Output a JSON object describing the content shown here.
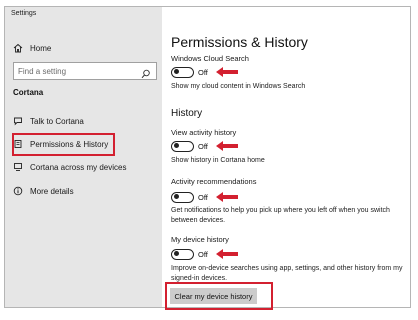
{
  "window": {
    "title": "Settings"
  },
  "sidebar": {
    "home_label": "Home",
    "search_placeholder": "Find a setting",
    "section_title": "Cortana",
    "items": [
      {
        "label": "Talk to Cortana",
        "icon": "cortana-chat-icon"
      },
      {
        "label": "Permissions & History",
        "icon": "permissions-icon",
        "highlighted": true
      },
      {
        "label": "Cortana across my devices",
        "icon": "devices-icon"
      },
      {
        "label": "More details",
        "icon": "info-icon"
      }
    ]
  },
  "main": {
    "title": "Permissions & History",
    "cloud_search": {
      "label": "Windows Cloud Search",
      "state": "Off",
      "description": "Show my cloud content in Windows Search"
    },
    "history_heading": "History",
    "activity_history": {
      "label": "View activity history",
      "state": "Off",
      "description": "Show history in Cortana home"
    },
    "activity_recommendations": {
      "label": "Activity recommendations",
      "state": "Off",
      "description": "Get notifications to help you pick up where you left off when you switch between devices."
    },
    "device_history": {
      "label": "My device history",
      "state": "Off",
      "description": "Improve on-device searches using app, settings, and other history from my signed-in devices."
    },
    "clear_button": "Clear my device history"
  },
  "colors": {
    "annotation_red": "#d32030",
    "sidebar_bg": "#e6e6e6",
    "button_bg": "#cccccc"
  }
}
